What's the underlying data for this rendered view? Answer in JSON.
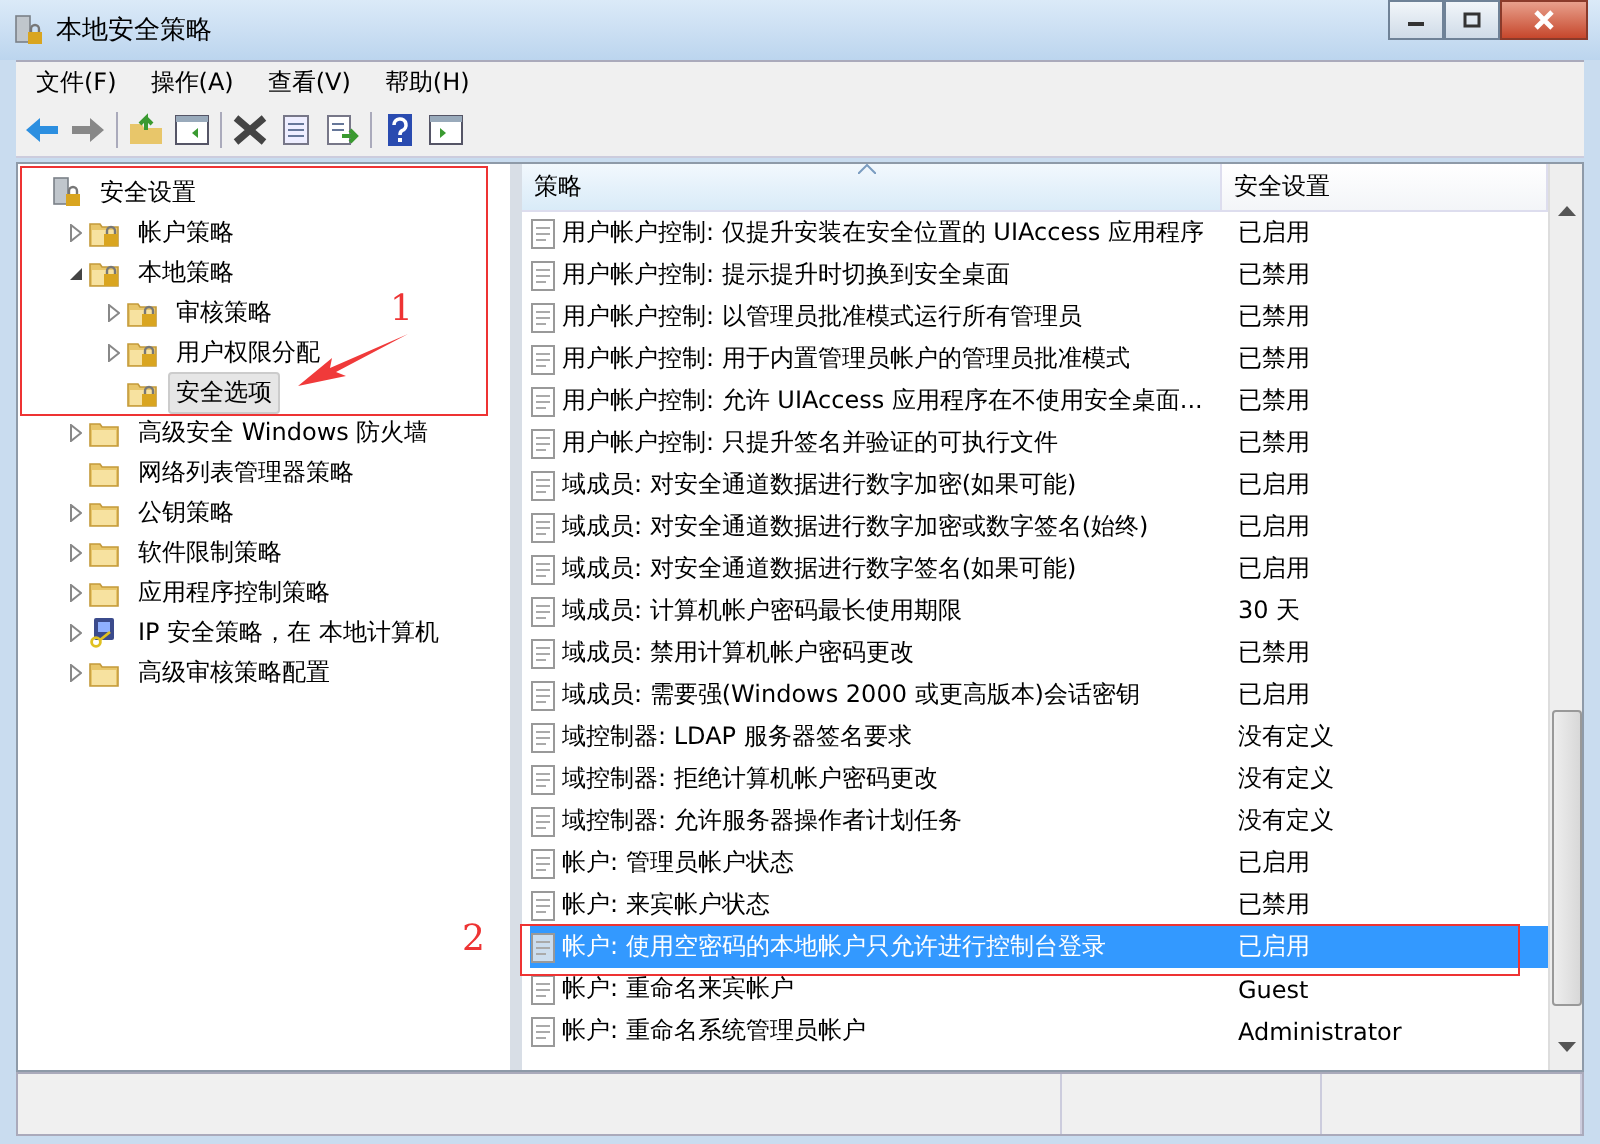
{
  "window": {
    "title": "本地安全策略"
  },
  "menu": [
    "文件(F)",
    "操作(A)",
    "查看(V)",
    "帮助(H)"
  ],
  "tree": [
    {
      "label": "安全设置",
      "kind": "root",
      "children": [
        {
          "label": "帐户策略",
          "kind": "lock-folder",
          "expanded": false
        },
        {
          "label": "本地策略",
          "kind": "lock-folder",
          "expanded": true,
          "children": [
            {
              "label": "审核策略",
              "kind": "lock-folder",
              "expanded": false,
              "selected": false
            },
            {
              "label": "用户权限分配",
              "kind": "lock-folder",
              "expanded": false,
              "selected": false
            },
            {
              "label": "安全选项",
              "kind": "lock-folder",
              "selected": true
            }
          ]
        },
        {
          "label": "高级安全 Windows 防火墙",
          "kind": "folder",
          "expanded": false
        },
        {
          "label": "网络列表管理器策略",
          "kind": "folder"
        },
        {
          "label": "公钥策略",
          "kind": "folder",
          "expanded": false
        },
        {
          "label": "软件限制策略",
          "kind": "folder",
          "expanded": false
        },
        {
          "label": "应用程序控制策略",
          "kind": "folder",
          "expanded": false
        },
        {
          "label": "IP 安全策略，在 本地计算机",
          "kind": "ip",
          "expanded": false
        },
        {
          "label": "高级审核策略配置",
          "kind": "folder",
          "expanded": false
        }
      ]
    }
  ],
  "table": {
    "columns": [
      "策略",
      "安全设置"
    ],
    "rows": [
      {
        "policy": "用户帐户控制: 仅提升安装在安全位置的 UIAccess 应用程序",
        "setting": "已启用",
        "selected": false
      },
      {
        "policy": "用户帐户控制: 提示提升时切换到安全桌面",
        "setting": "已禁用",
        "selected": false
      },
      {
        "policy": "用户帐户控制: 以管理员批准模式运行所有管理员",
        "setting": "已禁用",
        "selected": false
      },
      {
        "policy": "用户帐户控制: 用于内置管理员帐户的管理员批准模式",
        "setting": "已禁用",
        "selected": false
      },
      {
        "policy": "用户帐户控制: 允许 UIAccess 应用程序在不使用安全桌面...",
        "setting": "已禁用",
        "selected": false
      },
      {
        "policy": "用户帐户控制: 只提升签名并验证的可执行文件",
        "setting": "已禁用",
        "selected": false
      },
      {
        "policy": "域成员: 对安全通道数据进行数字加密(如果可能)",
        "setting": "已启用",
        "selected": false
      },
      {
        "policy": "域成员: 对安全通道数据进行数字加密或数字签名(始终)",
        "setting": "已启用",
        "selected": false
      },
      {
        "policy": "域成员: 对安全通道数据进行数字签名(如果可能)",
        "setting": "已启用",
        "selected": false
      },
      {
        "policy": "域成员: 计算机帐户密码最长使用期限",
        "setting": "30 天",
        "selected": false
      },
      {
        "policy": "域成员: 禁用计算机帐户密码更改",
        "setting": "已禁用",
        "selected": false
      },
      {
        "policy": "域成员: 需要强(Windows 2000 或更高版本)会话密钥",
        "setting": "已启用",
        "selected": false
      },
      {
        "policy": "域控制器: LDAP 服务器签名要求",
        "setting": "没有定义",
        "selected": false
      },
      {
        "policy": "域控制器: 拒绝计算机帐户密码更改",
        "setting": "没有定义",
        "selected": false
      },
      {
        "policy": "域控制器: 允许服务器操作者计划任务",
        "setting": "没有定义",
        "selected": false
      },
      {
        "policy": "帐户: 管理员帐户状态",
        "setting": "已启用",
        "selected": false
      },
      {
        "policy": "帐户: 来宾帐户状态",
        "setting": "已禁用",
        "selected": false
      },
      {
        "policy": "帐户: 使用空密码的本地帐户只允许进行控制台登录",
        "setting": "已启用",
        "selected": true
      },
      {
        "policy": "帐户: 重命名来宾帐户",
        "setting": "Guest",
        "selected": false
      },
      {
        "policy": "帐户: 重命名系统管理员帐户",
        "setting": "Administrator",
        "selected": false
      }
    ]
  },
  "annotations": [
    {
      "label": "1"
    },
    {
      "label": "2"
    }
  ]
}
